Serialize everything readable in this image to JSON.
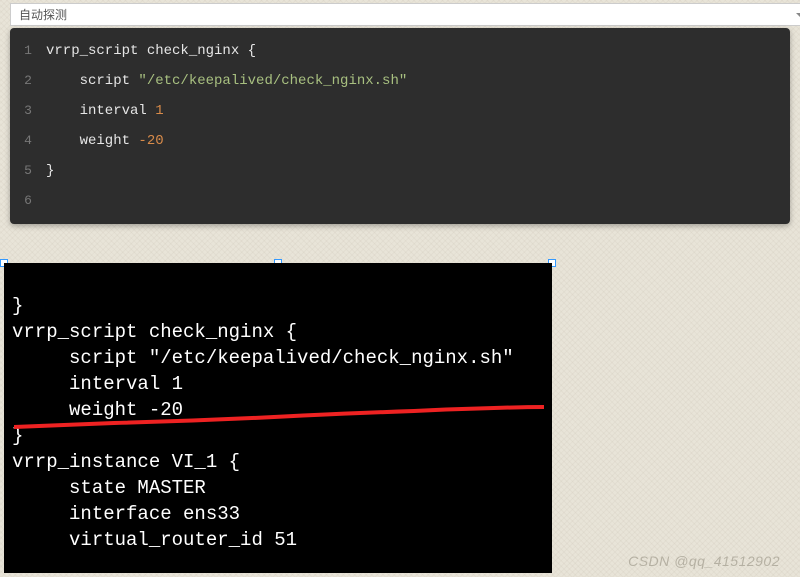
{
  "dropdown": {
    "label": "自动探测"
  },
  "code": {
    "lines": [
      {
        "num": "1",
        "tokens": [
          {
            "t": "vrrp_script check_nginx {",
            "c": "kw"
          }
        ]
      },
      {
        "num": "2",
        "tokens": [
          {
            "t": "    script ",
            "c": "kw"
          },
          {
            "t": "\"/etc/keepalived/check_nginx.sh\"",
            "c": "str"
          }
        ]
      },
      {
        "num": "3",
        "tokens": [
          {
            "t": "    interval ",
            "c": "kw"
          },
          {
            "t": "1",
            "c": "num"
          }
        ]
      },
      {
        "num": "4",
        "tokens": [
          {
            "t": "    weight ",
            "c": "kw"
          },
          {
            "t": "-20",
            "c": "num"
          }
        ]
      },
      {
        "num": "5",
        "tokens": [
          {
            "t": "}",
            "c": "kw"
          }
        ]
      },
      {
        "num": "6",
        "tokens": [
          {
            "t": "",
            "c": "kw"
          }
        ]
      }
    ]
  },
  "terminal": {
    "lines": [
      "}",
      "vrrp_script check_nginx {",
      "     script \"/etc/keepalived/check_nginx.sh\"",
      "     interval 1",
      "     weight -20",
      "}",
      "vrrp_instance VI_1 {",
      "     state MASTER",
      "     interface ens33",
      "     virtual_router_id 51"
    ]
  },
  "watermark": "CSDN @qq_41512902"
}
